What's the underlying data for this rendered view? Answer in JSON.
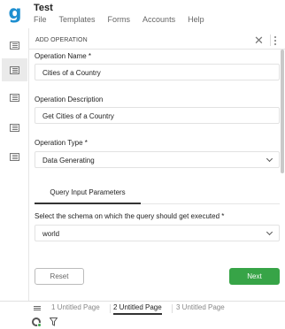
{
  "app": {
    "title": "Test",
    "logo_letter": "g",
    "menu": [
      "File",
      "Templates",
      "Forms",
      "Accounts",
      "Help"
    ]
  },
  "sidebar": {
    "items": [
      {
        "icon": "list-icon",
        "active": false
      },
      {
        "icon": "list-icon",
        "active": true
      },
      {
        "icon": "list-icon",
        "active": false
      },
      {
        "icon": "list-icon",
        "active": false
      },
      {
        "icon": "list-icon",
        "active": false
      }
    ]
  },
  "panel": {
    "title": "ADD OPERATION",
    "close_icon": "close-icon",
    "more_icon": "more-vertical-icon",
    "operation_name": {
      "label": "Operation Name *",
      "value": "Cities of a Country"
    },
    "operation_description": {
      "label": "Operation Description",
      "value": "Get Cities of a Country"
    },
    "operation_type": {
      "label": "Operation Type *",
      "value": "Data Generating"
    },
    "tabs": [
      {
        "label": "Query Input Parameters",
        "active": true
      }
    ],
    "schema": {
      "label": "Select the schema on which the query should get executed *",
      "value": "world"
    },
    "reset_label": "Reset",
    "next_label": "Next"
  },
  "colors": {
    "accent": "#37a447",
    "logo": "#1e8fd0"
  },
  "page_tabs": [
    {
      "label": "1 Untitled Page",
      "active": false
    },
    {
      "label": "2 Untitled Page",
      "active": true
    },
    {
      "label": "3 Untitled Page",
      "active": false
    }
  ],
  "bottom_tools": {
    "settings_icon": "gear-icon",
    "filter_icon": "filter-icon"
  }
}
